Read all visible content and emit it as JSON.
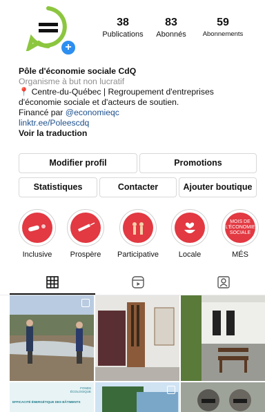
{
  "profile": {
    "name": "Pôle d'économie sociale CdQ",
    "category": "Organisme à but non lucratif",
    "bio_pin": "📍",
    "bio_line1": "Centre-du-Québec | Regroupement d'entreprises",
    "bio_line2": "d'économie sociale et d'acteurs de soutien.",
    "funded_by": "Financé par ",
    "mention": "@economieqc",
    "link": "linktr.ee/Poleescdq",
    "translate": "Voir la traduction"
  },
  "stats": [
    {
      "value": "38",
      "label": "Publications"
    },
    {
      "value": "83",
      "label": "Abonnés"
    },
    {
      "value": "59",
      "label": "Abonnements"
    }
  ],
  "buttons": {
    "edit_profile": "Modifier profil",
    "promotions": "Promotions",
    "insights": "Statistiques",
    "contact": "Contacter",
    "add_shop": "Ajouter boutique"
  },
  "highlights": [
    {
      "label": "Inclusive",
      "icon": "pills-icon"
    },
    {
      "label": "Prospère",
      "icon": "syringe-icon"
    },
    {
      "label": "Participative",
      "icon": "hands-icon"
    },
    {
      "label": "Locale",
      "icon": "heart-bowl-icon"
    },
    {
      "label": "MÉS",
      "icon": "text-badge-icon"
    }
  ],
  "highlight_badge_text": "MOIS DE L'ÉCONOMIE SOCIALE",
  "tabs": [
    "grid-icon",
    "reels-icon",
    "tagged-icon"
  ],
  "posts": [
    {
      "caption": ""
    },
    {
      "caption": ""
    },
    {
      "caption": ""
    },
    {
      "caption": "EFFICACITÉ ÉNERGÉTIQUE DES BÂTIMENTS"
    },
    {
      "caption": ""
    },
    {
      "caption": ""
    }
  ],
  "post_overlay_text": "FONDS ÉCOLOGIQUE",
  "colors": {
    "brand_green": "#8cc63f",
    "highlight_red": "#e23942",
    "link_blue": "#1c4f8c",
    "add_blue": "#2d8ff0"
  }
}
